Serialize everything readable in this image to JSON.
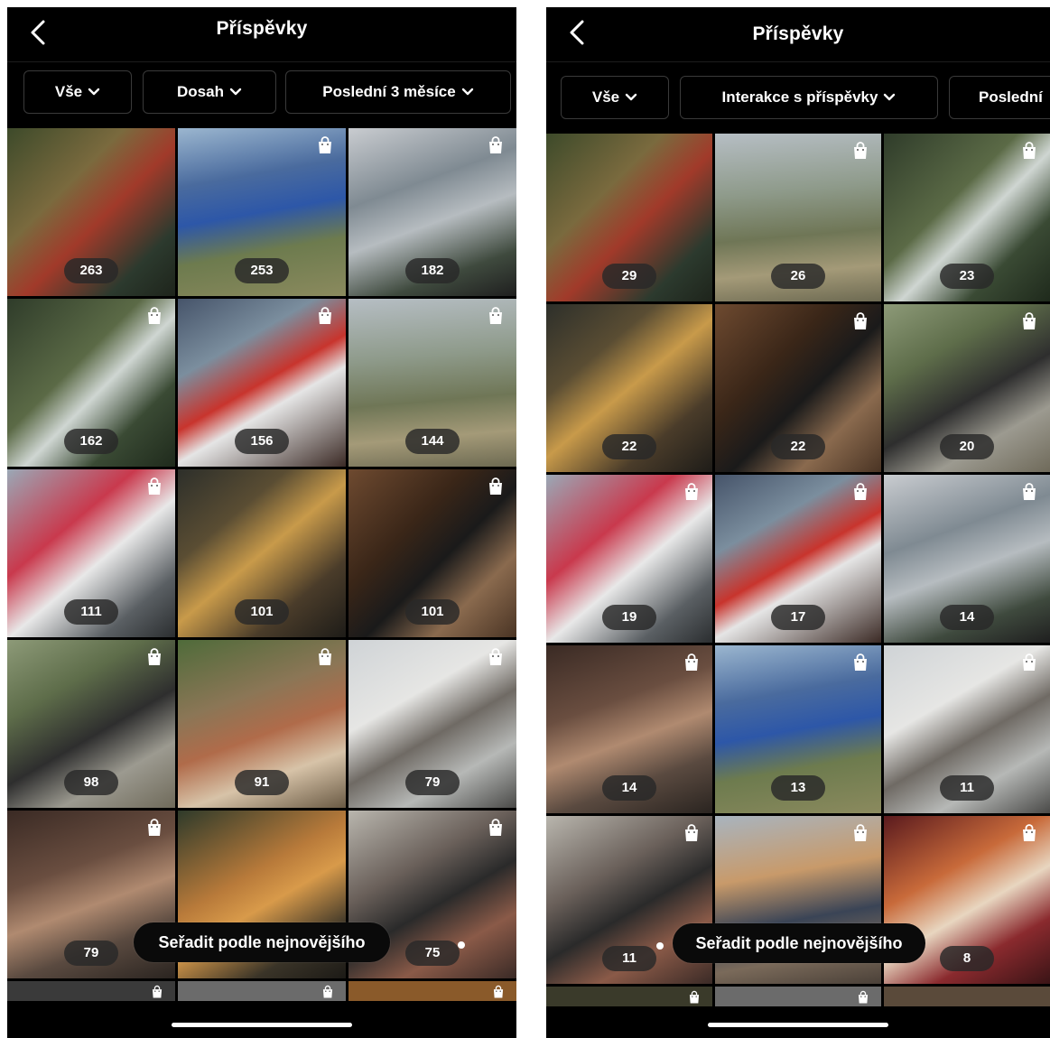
{
  "left": {
    "title": "Příspěvky",
    "filters": [
      "Vše",
      "Dosah",
      "Poslední 3 měsíce"
    ],
    "sort_label": "Seřadit podle nejnovějšího",
    "posts": [
      {
        "value": "263",
        "bg": "linear-gradient(135deg,#3d4a2a 0%,#7a6a3e 35%,#a13a2a 55%,#2c3a2e 80%,#1e241b 100%)",
        "shop": false
      },
      {
        "value": "253",
        "bg": "linear-gradient(170deg,#9bb6cf 0%,#4a6b9e 30%,#2d57a8 50%,#6d7b4e 70%,#8b8a5e 100%)",
        "shop": true
      },
      {
        "value": "182",
        "bg": "linear-gradient(160deg,#c9ccd0 0%,#7f8a92 35%,#b6bcc0 55%,#3f4a3e 80%,#1f1f1f 100%)",
        "shop": true
      },
      {
        "value": "162",
        "bg": "linear-gradient(135deg,#2f3c2a 0%,#5b6a46 40%,#cfd6d2 55%,#3a4a34 75%,#1f2a1c 100%)",
        "shop": true
      },
      {
        "value": "156",
        "bg": "linear-gradient(150deg,#46546a 0%,#7b8e9e 30%,#c8342d 50%,#e5e5e5 62%,#3b2a25 100%)",
        "shop": true
      },
      {
        "value": "144",
        "bg": "linear-gradient(175deg,#b6bec4 0%,#8e9a8a 35%,#6f7656 60%,#a49a78 80%,#6d6a52 100%)",
        "shop": true
      },
      {
        "value": "111",
        "bg": "linear-gradient(140deg,#9aa8b6 0%,#c9394d 35%,#e8e8e8 55%,#5a5f63 80%,#2b2e30 100%)",
        "shop": true
      },
      {
        "value": "101",
        "bg": "linear-gradient(140deg,#2d2f2a 0%,#5a4d33 30%,#c89a4a 50%,#4a3c2a 75%,#1e1c18 100%)",
        "shop": false
      },
      {
        "value": "101",
        "bg": "linear-gradient(135deg,#6e4a30 0%,#3a2618 35%,#1a1a1a 55%,#8a6a4e 75%,#4a3424 100%)",
        "shop": true
      },
      {
        "value": "98",
        "bg": "linear-gradient(150deg,#8d9a78 0%,#5e6d4a 30%,#2e2e2e 55%,#9c9a90 75%,#6f6a5a 100%)",
        "shop": true
      },
      {
        "value": "91",
        "bg": "linear-gradient(160deg,#4f6b3a 0%,#8b7656 35%,#b06b4a 55%,#d7c3a8 75%,#6a5a44 100%)",
        "shop": true
      },
      {
        "value": "79",
        "bg": "linear-gradient(150deg,#cfd3d6 0%,#e6e6e4 35%,#6f6a64 55%,#b6b8b6 75%,#4a4a48 100%)",
        "shop": true
      },
      {
        "value": "79",
        "bg": "linear-gradient(160deg,#3a2a24 0%,#6a4e40 35%,#b08a70 55%,#5a4a40 75%,#2a2420 100%)",
        "shop": true
      },
      {
        "value": "",
        "bg": "linear-gradient(150deg,#2e3a2a 0%,#b87a3a 40%,#d89a4a 55%,#3a3428 80%,#1c1a16 100%)",
        "shop": false
      },
      {
        "value": "75",
        "bg": "linear-gradient(150deg,#b9b6ae 0%,#6a605a 35%,#2a2a2a 55%,#8a5a48 75%,#3a2a26 100%)",
        "shop": true
      }
    ],
    "partial_row": [
      {
        "bg": "#3a3a3a",
        "shop": true
      },
      {
        "bg": "#6b6b6b",
        "shop": true
      },
      {
        "bg": "#8a5a2a",
        "shop": true
      }
    ]
  },
  "right": {
    "title": "Příspěvky",
    "filters": [
      "Vše",
      "Interakce s příspěvky",
      "Poslední"
    ],
    "sort_label": "Seřadit podle nejnovějšího",
    "posts": [
      {
        "value": "29",
        "bg": "linear-gradient(135deg,#3d4a2a 0%,#7a6a3e 35%,#a13a2a 55%,#2c3a2e 80%,#1e241b 100%)",
        "shop": false
      },
      {
        "value": "26",
        "bg": "linear-gradient(175deg,#b6bec4 0%,#8e9a8a 35%,#6f7656 60%,#a49a78 80%,#6d6a52 100%)",
        "shop": true
      },
      {
        "value": "23",
        "bg": "linear-gradient(135deg,#2f3c2a 0%,#5b6a46 40%,#cfd6d2 55%,#3a4a34 75%,#1f2a1c 100%)",
        "shop": true
      },
      {
        "value": "22",
        "bg": "linear-gradient(140deg,#2d2f2a 0%,#5a4d33 30%,#c89a4a 50%,#4a3c2a 75%,#1e1c18 100%)",
        "shop": false
      },
      {
        "value": "22",
        "bg": "linear-gradient(135deg,#6e4a30 0%,#3a2618 35%,#1a1a1a 55%,#8a6a4e 75%,#4a3424 100%)",
        "shop": true
      },
      {
        "value": "20",
        "bg": "linear-gradient(150deg,#8d9a78 0%,#5e6d4a 30%,#2e2e2e 55%,#9c9a90 75%,#6f6a5a 100%)",
        "shop": true
      },
      {
        "value": "19",
        "bg": "linear-gradient(140deg,#9aa8b6 0%,#c9394d 35%,#e8e8e8 55%,#5a5f63 80%,#2b2e30 100%)",
        "shop": true
      },
      {
        "value": "17",
        "bg": "linear-gradient(150deg,#46546a 0%,#7b8e9e 30%,#c8342d 50%,#e5e5e5 62%,#3b2a25 100%)",
        "shop": true
      },
      {
        "value": "14",
        "bg": "linear-gradient(160deg,#c9ccd0 0%,#7f8a92 35%,#b6bcc0 55%,#3f4a3e 80%,#1f1f1f 100%)",
        "shop": true
      },
      {
        "value": "14",
        "bg": "linear-gradient(160deg,#3a2a24 0%,#6a4e40 35%,#b08a70 55%,#5a4a40 75%,#2a2420 100%)",
        "shop": true
      },
      {
        "value": "13",
        "bg": "linear-gradient(170deg,#9bb6cf 0%,#4a6b9e 30%,#2d57a8 50%,#6d7b4e 70%,#8b8a5e 100%)",
        "shop": true
      },
      {
        "value": "11",
        "bg": "linear-gradient(150deg,#cfd3d6 0%,#e6e6e4 35%,#6f6a64 55%,#b6b8b6 75%,#4a4a48 100%)",
        "shop": true
      },
      {
        "value": "11",
        "bg": "linear-gradient(150deg,#b9b6ae 0%,#6a605a 35%,#2a2a2a 55%,#8a5a48 75%,#3a2a26 100%)",
        "shop": true
      },
      {
        "value": "",
        "bg": "linear-gradient(170deg,#a8b4bf 0%,#c89a6a 35%,#3a4456 60%,#7a6a5a 80%,#4a4038 100%)",
        "shop": true
      },
      {
        "value": "8",
        "bg": "linear-gradient(150deg,#5a1a1e 0%,#c86a3a 35%,#e8d6c0 55%,#8a2a2e 75%,#3a1416 100%)",
        "shop": true
      }
    ],
    "partial_row": [
      {
        "bg": "#3a3a2a",
        "shop": true
      },
      {
        "bg": "#6b6b6b",
        "shop": true
      },
      {
        "bg": "#5a4a3a",
        "shop": false
      }
    ]
  }
}
